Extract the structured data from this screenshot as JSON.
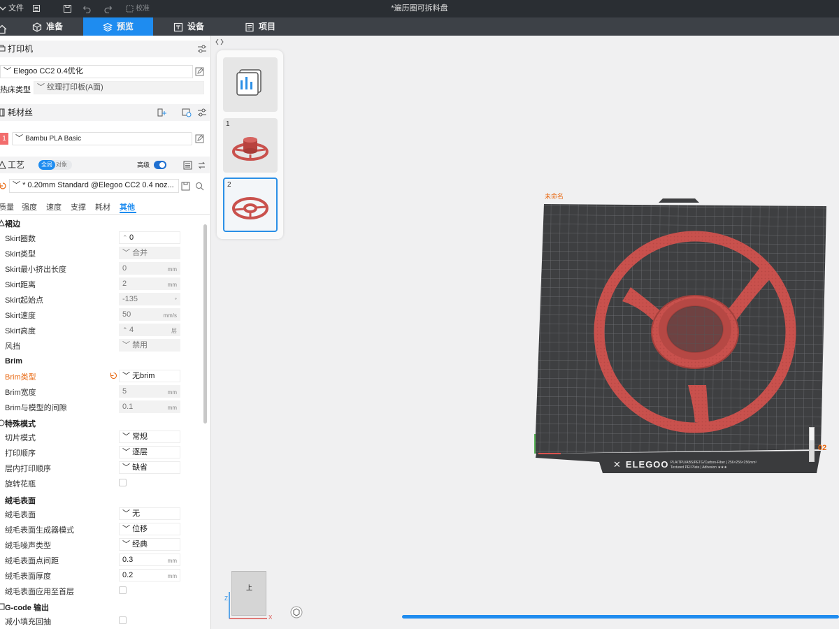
{
  "titlebar": {
    "file_label": "文件",
    "check_label": "校准",
    "window_title": "*遍历圈可拆料盘"
  },
  "nav": {
    "tabs": [
      {
        "label": "准备"
      },
      {
        "label": "预览"
      },
      {
        "label": "设备"
      },
      {
        "label": "项目"
      }
    ],
    "active_index": 1
  },
  "printer": {
    "section_label": "打印机",
    "preset": "Elegoo CC2  0.4优化",
    "bed_type_label": "热床类型",
    "bed_type": "纹理打印板(A面)"
  },
  "filament": {
    "section_label": "耗材丝",
    "slot": "1",
    "preset": "Bambu PLA Basic",
    "slot_color": "#f26d6d"
  },
  "process": {
    "section_label": "工艺",
    "scope_global": "全局",
    "scope_object": "对象",
    "advanced_label": "高级",
    "advanced_on": true,
    "preset": "* 0.20mm Standard @Elegoo CC2 0.4 noz...",
    "subtabs": [
      "质量",
      "强度",
      "速度",
      "支撑",
      "耗材",
      "其他"
    ],
    "active_subtab": 5
  },
  "groups": {
    "skirt": "裙边",
    "brim": "Brim",
    "special": "特殊模式",
    "fuzzy": "绒毛表面",
    "gcode": "G-code 输出"
  },
  "settings": {
    "skirt_loops": {
      "label": "Skirt圈数",
      "value": "0"
    },
    "skirt_type": {
      "label": "Skirt类型",
      "value": "合并"
    },
    "skirt_min_len": {
      "label": "Skirt最小挤出长度",
      "value": "0",
      "unit": "mm"
    },
    "skirt_dist": {
      "label": "Skirt距离",
      "value": "2",
      "unit": "mm"
    },
    "skirt_start": {
      "label": "Skirt起始点",
      "value": "-135",
      "unit": "°"
    },
    "skirt_speed": {
      "label": "Skirt速度",
      "value": "50",
      "unit": "mm/s"
    },
    "skirt_height": {
      "label": "Skirt高度",
      "value": "4",
      "unit": "层"
    },
    "draft_shield": {
      "label": "风挡",
      "value": "禁用"
    },
    "brim_type": {
      "label": "Brim类型",
      "value": "无brim"
    },
    "brim_width": {
      "label": "Brim宽度",
      "value": "5",
      "unit": "mm"
    },
    "brim_gap": {
      "label": "Brim与模型的间隙",
      "value": "0.1",
      "unit": "mm"
    },
    "slice_mode": {
      "label": "切片模式",
      "value": "常规"
    },
    "print_seq": {
      "label": "打印顺序",
      "value": "逐层"
    },
    "intra_layer": {
      "label": "层内打印顺序",
      "value": "缺省"
    },
    "spiral_vase": {
      "label": "旋转花瓶"
    },
    "fuzzy_skin": {
      "label": "绒毛表面",
      "value": "无"
    },
    "fuzzy_gen": {
      "label": "绒毛表面生成器模式",
      "value": "位移"
    },
    "fuzzy_noise": {
      "label": "绒毛噪声类型",
      "value": "经典"
    },
    "fuzzy_dist": {
      "label": "绒毛表面点间距",
      "value": "0.3",
      "unit": "mm"
    },
    "fuzzy_thick": {
      "label": "绒毛表面厚度",
      "value": "0.2",
      "unit": "mm"
    },
    "fuzzy_first": {
      "label": "绒毛表面应用至首层"
    },
    "reduce_retract": {
      "label": "减小填充回抽"
    }
  },
  "plates": {
    "items": [
      "1",
      "2"
    ],
    "selected": "2"
  },
  "bed": {
    "plate_name": "未命名",
    "brand": "ELEGOO",
    "spec_line1": "PLA/TPU/ABS/PETG/Carbon-Fiber  |  256×256×256mm³",
    "spec_line2": "Textured PEI Plate  |  Adhesion ★★★",
    "layer_readout": "02"
  },
  "navcube": {
    "face": "上",
    "axis_x": "X",
    "axis_z": "Z"
  },
  "colors": {
    "accent": "#1e8cf0",
    "model_red": "#c9514d",
    "bed": "#3e3f41"
  }
}
